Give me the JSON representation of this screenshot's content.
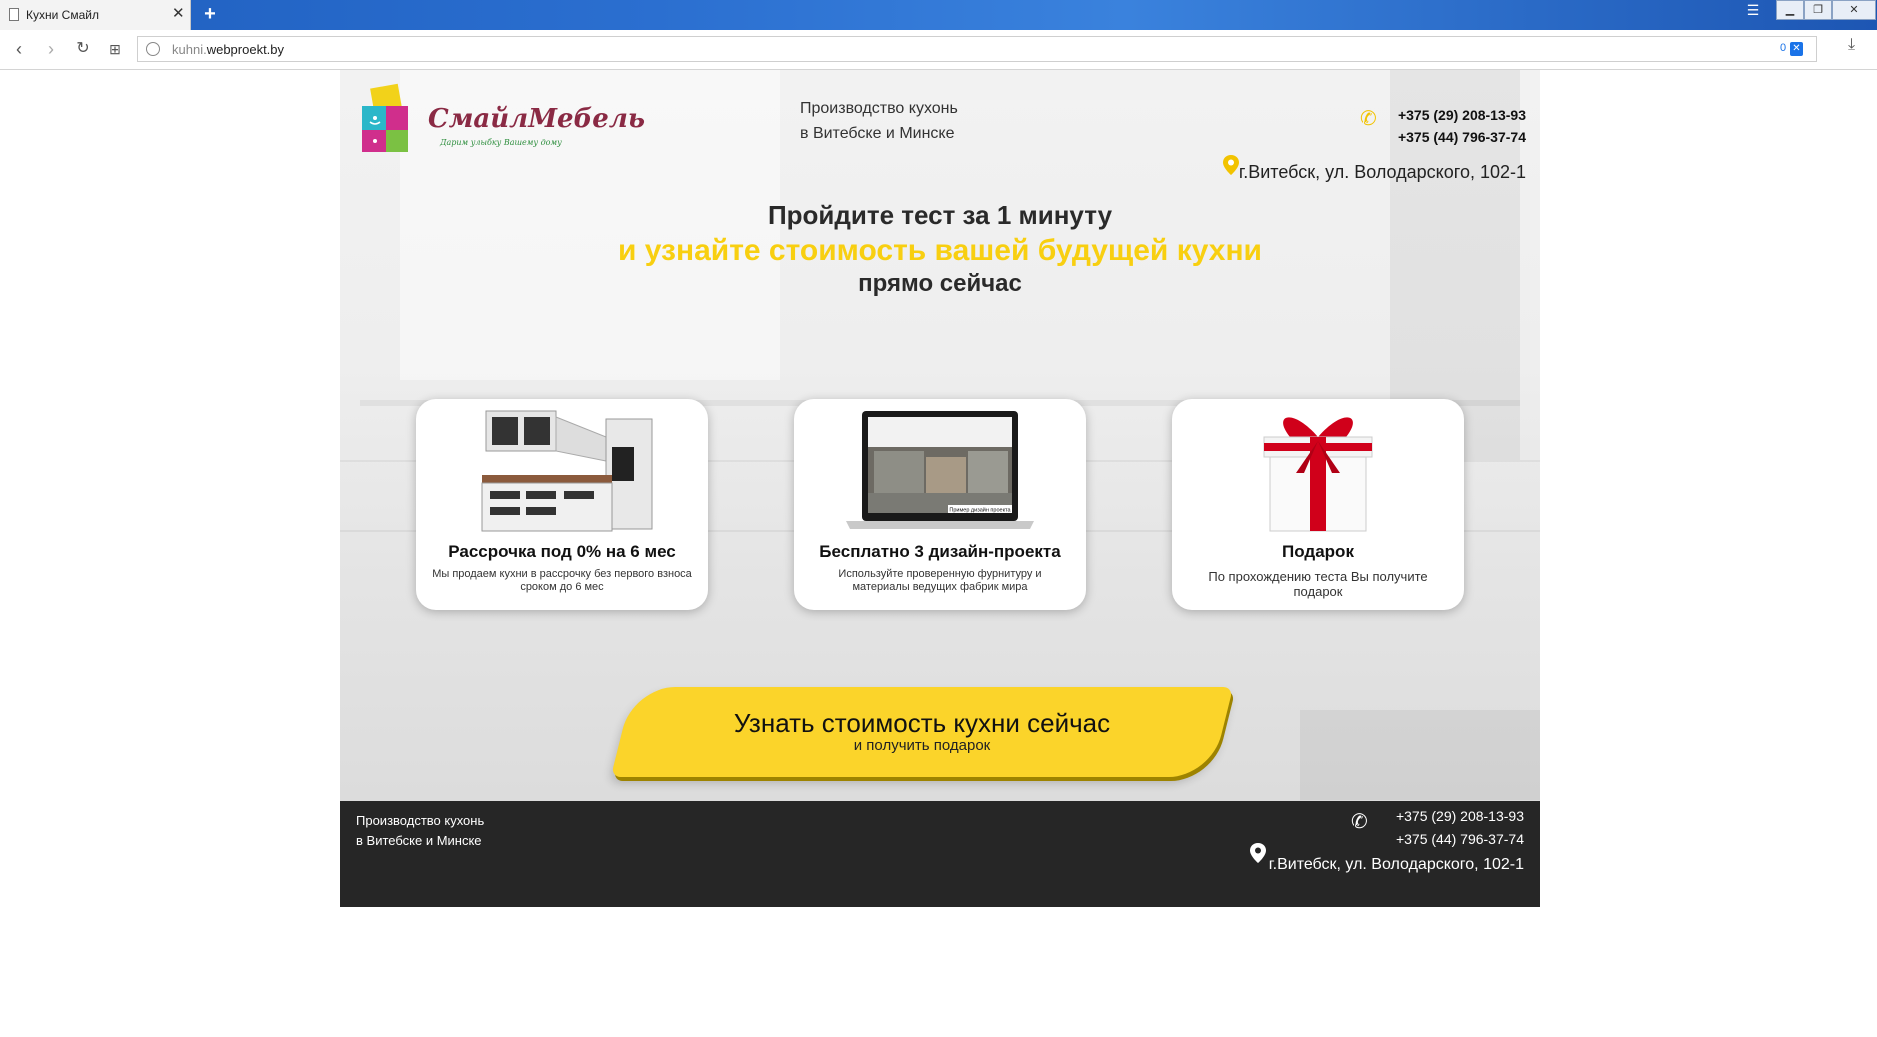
{
  "browser": {
    "tab_title": "Кухни Смайл",
    "tab_close": "✕",
    "new_tab": "+",
    "url_host_prefix": "kuhni.",
    "url_host_main": "webproekt.by",
    "badge_count": "0"
  },
  "header": {
    "logo_text": "СмайлМебель",
    "logo_sub": "Дарим улыбку Вашему дому",
    "production_line1": "Производство кухонь",
    "production_line2": "в Витебске и Минске",
    "phone1": "+375 (29) 208-13-93",
    "phone2": "+375 (44) 796-37-74",
    "address": "г.Витебск, ул. Володарского, 102-1"
  },
  "hero": {
    "line1": "Пройдите тест за 1 минуту",
    "line2": "и узнайте стоимость вашей будущей кухни",
    "line3": "прямо сейчас"
  },
  "cards": [
    {
      "title": "Рассрочка под 0% на 6 мес",
      "desc": "Мы продаем кухни в рассрочку без первого взноса сроком до 6 мес"
    },
    {
      "title": "Бесплатно 3 дизайн-проекта",
      "desc": "Используйте проверенную фурнитуру и материалы ведущих фабрик мира",
      "image_caption": "Пример дизайн проекта"
    },
    {
      "title": "Подарок",
      "desc": "По прохождению теста Вы получите подарок"
    }
  ],
  "cta": {
    "title": "Узнать стоимость кухни сейчас",
    "subtitle": "и получить подарок"
  },
  "footer": {
    "production_line1": "Производство кухонь",
    "production_line2": "в Витебске и Минске",
    "phone1": "+375 (29) 208-13-93",
    "phone2": "+375 (44) 796-37-74",
    "address": "г.Витебск, ул. Володарского, 102-1"
  },
  "colors": {
    "accent_yellow": "#fbd42a",
    "headline_yellow": "#f8cf10",
    "footer_bg": "#262626",
    "titlebar_blue": "#2b6fd0"
  },
  "icons": [
    "document-icon",
    "close-icon",
    "plus-icon",
    "menu-icon",
    "minimize-icon",
    "maximize-icon",
    "back-icon",
    "forward-icon",
    "reload-icon",
    "grid-icon",
    "globe-icon",
    "shield-icon",
    "heart-icon",
    "download-icon",
    "phone-icon",
    "map-pin-icon"
  ]
}
